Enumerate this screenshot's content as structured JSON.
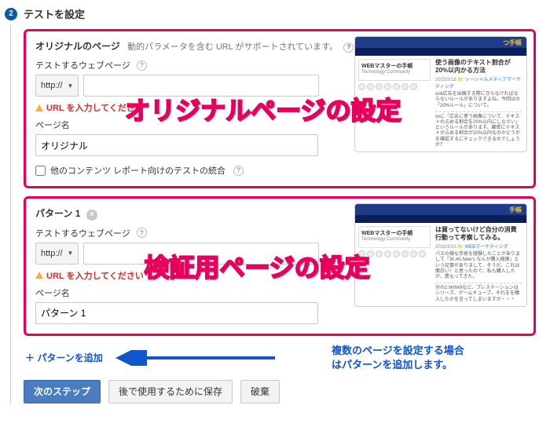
{
  "step": {
    "num": "2",
    "title": "テストを設定"
  },
  "original": {
    "heading": "オリジナルのページ",
    "note": "動的パラメータを含む URL がサポートされています。",
    "label_webpage": "テストするウェブページ",
    "protocol": "http://",
    "url_placeholder": "",
    "warn": "URL を入力してください",
    "label_name": "ページ名",
    "name_value": "オリジナル",
    "checkbox_label": "他のコンテンツ レポート向けのテストの統合",
    "overlay": "オリジナルページの設定"
  },
  "pattern": {
    "heading": "パターン 1",
    "label_webpage": "テストするウェブページ",
    "protocol": "http://",
    "warn": "URL を入力してください",
    "label_name": "ページ名",
    "name_value": "パターン 1",
    "overlay": "検証用ページの設定"
  },
  "preview1": {
    "topbrand": "つ手帳",
    "card_title": "WEBマスターの手帳",
    "card_sub": "Technology Community",
    "headline": "使う画像のテキスト割合が20%以内かる方法",
    "meta_date": "2015/3/18",
    "meta_tag": "ソーシャルメディアマーケティング",
    "body1": "ook広告を出稿する際に守らなければならないルールがありますよね。今回はの「20%ルール」について。",
    "body2": "xxに「広告に使う画像について、テキストの占める割合を20%以内にしなさい」というルールがあります。厳密にテキストが占める割合が20%以内なのかどうかを確認するにチェックできるのでしょうか？"
  },
  "preview2": {
    "topbrand": "手帳",
    "card_title": "WEBマスターの手帳",
    "card_sub": "Technology Community",
    "headline": "は買ってないけど自分の消費行動って考察してみる。",
    "meta_date": "2015/3/15",
    "meta_tag": "WEBマーケティング",
    "body1": "パスの様な手術を経験したことがありまして「30.40.New's なんか購入経緯」という記事がありまして、そうだ、これは面白い！と思ったので、私も購入したが、異なってきた。",
    "body2": "分の2.WIIWiiなど、プレステーションはシリーズ、ゲームキューブ、それをを購入したかを言ってしまいますが・・・"
  },
  "add_pattern": "＋ パターンを追加",
  "annotation_line1": "複数のページを設定する場合",
  "annotation_line2": "はパターンを追加します。",
  "buttons": {
    "next": "次のステップ",
    "save": "後で使用するために保存",
    "discard": "破棄"
  },
  "help_glyph": "?",
  "close_glyph": "×",
  "chev": "▼"
}
